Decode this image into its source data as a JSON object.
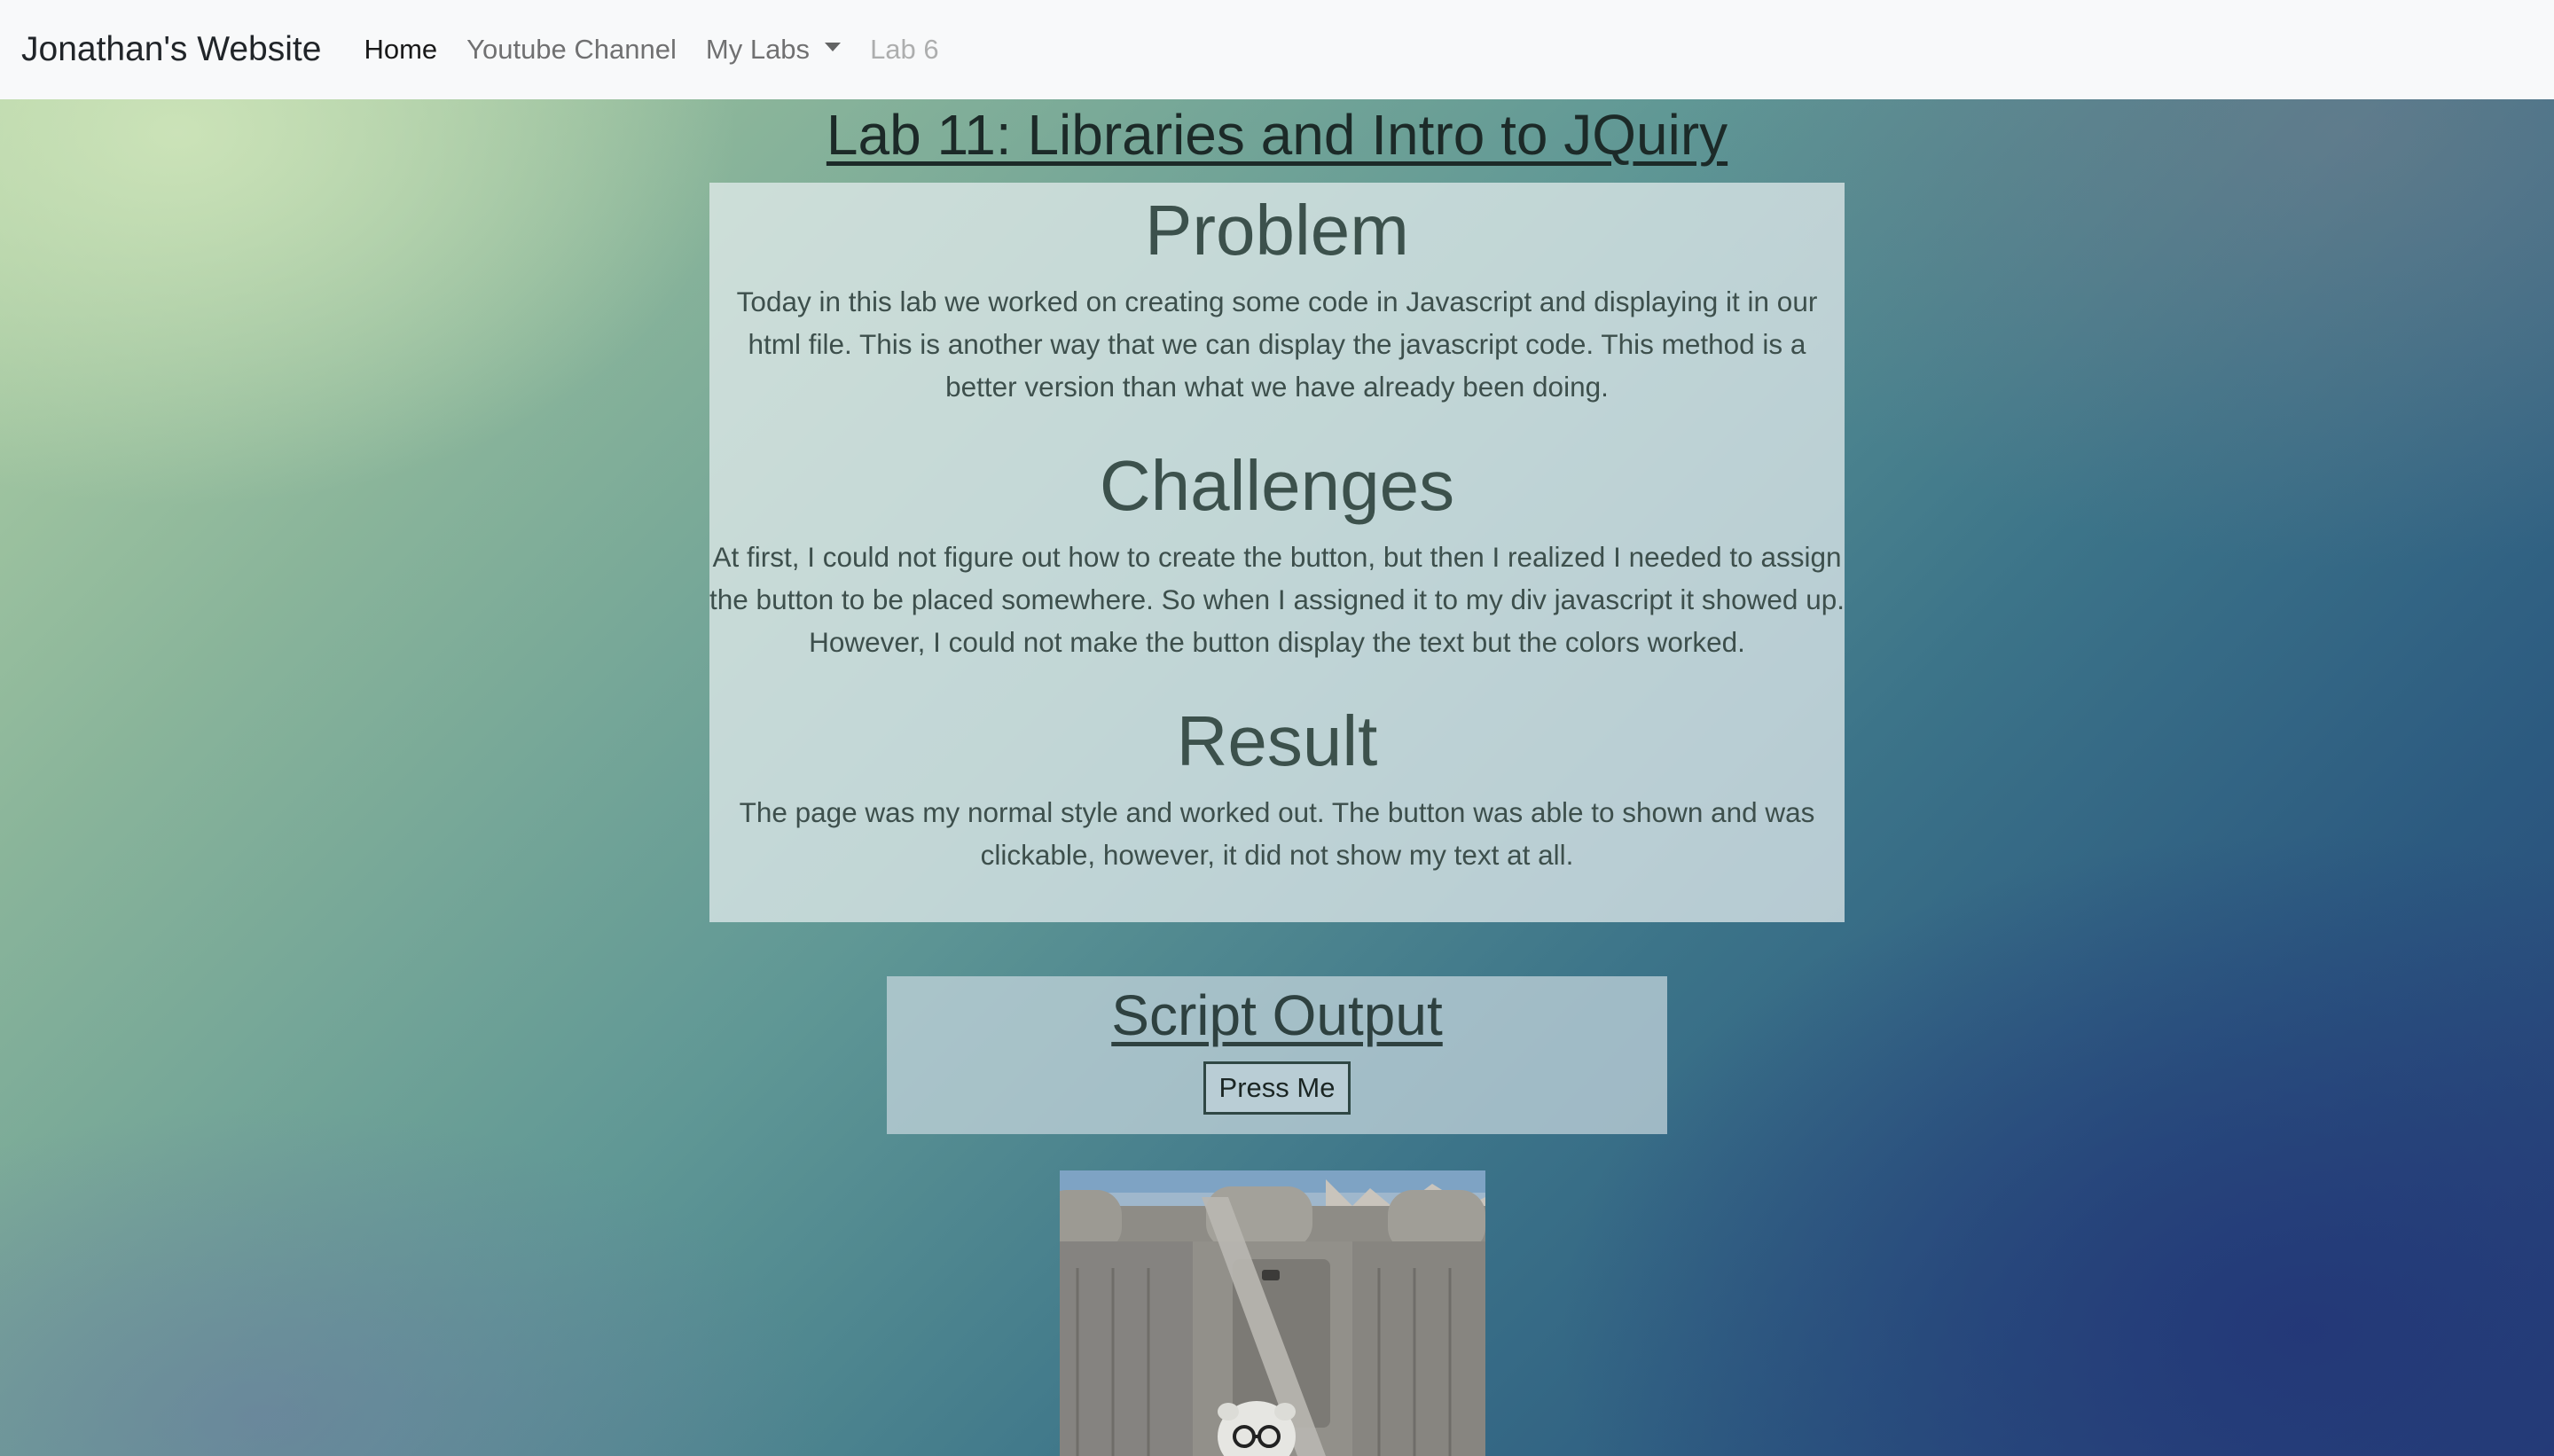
{
  "navbar": {
    "brand": "Jonathan's Website",
    "links": [
      {
        "label": "Home",
        "state": "active"
      },
      {
        "label": "Youtube Channel",
        "state": "normal"
      },
      {
        "label": "My Labs",
        "state": "dropdown"
      },
      {
        "label": "Lab 6",
        "state": "disabled"
      }
    ],
    "dropdown_icon": "caret-down-icon"
  },
  "main": {
    "title": "Lab 11: Libraries and Intro to JQuiry",
    "sections": [
      {
        "heading": "Problem",
        "text": "Today in this lab we worked on creating some code in Javascript and displaying it in our html file. This is another way that we can display the javascript code. This method is a better version than what we have already been doing."
      },
      {
        "heading": "Challenges",
        "text": "At first, I could not figure out how to create the button, but then I realized I needed to assign the button to be placed somewhere. So when I assigned it to my div javascript it showed up. However, I could not make the button display the text but the colors worked."
      },
      {
        "heading": "Result",
        "text": "The page was my normal style and worked out. The button was able to shown and was clickable, however, it did not show my text at all."
      }
    ]
  },
  "script_output": {
    "title": "Script Output",
    "button_label": "Press Me"
  },
  "colors": {
    "navbar_bg": "#f8f9fa",
    "card_text": "#364a47",
    "background_top_left": "#cde4b9",
    "background_bottom_right": "#263f78"
  }
}
